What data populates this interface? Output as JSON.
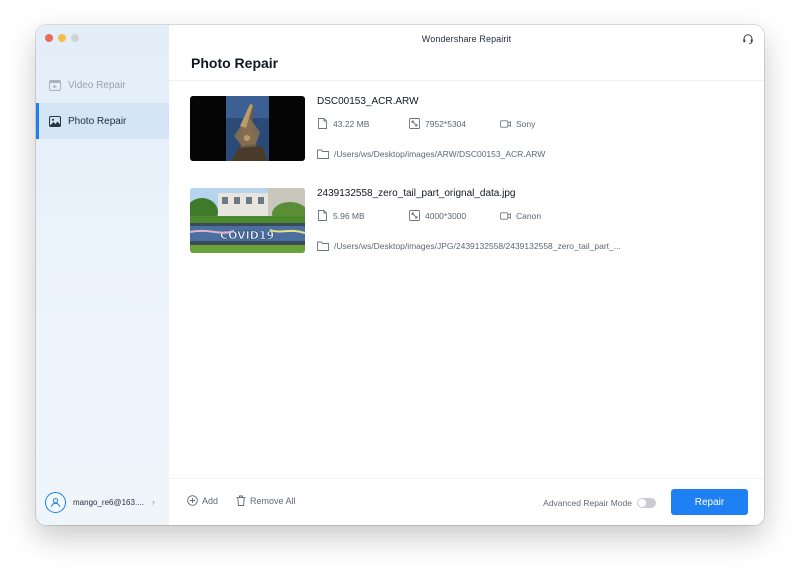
{
  "window": {
    "title": "Wondershare Repairit"
  },
  "colors": {
    "accent": "#1e80f2",
    "traffic_red": "#ec6a5e",
    "traffic_yellow": "#f4bf4f",
    "traffic_gray": "#d0d3d6"
  },
  "sidebar": {
    "items": [
      {
        "label": "Video Repair",
        "icon": "video-repair-icon",
        "active": false
      },
      {
        "label": "Photo Repair",
        "icon": "photo-repair-icon",
        "active": true
      }
    ],
    "user": {
      "name": "mango_re6@163....",
      "icon": "user-avatar-icon"
    }
  },
  "main": {
    "page_title": "Photo Repair",
    "files": [
      {
        "name": "DSC00153_ACR.ARW",
        "size": "43.22 MB",
        "resolution": "7952*5304",
        "camera": "Sony",
        "path": "/Users/ws/Desktop/images/ARW/DSC00153_ACR.ARW"
      },
      {
        "name": "2439132558_zero_tail_part_orignal_data.jpg",
        "size": "5.96 MB",
        "resolution": "4000*3000",
        "camera": "Canon",
        "path": "/Users/ws/Desktop/images/JPG/2439132558/2439132558_zero_tail_part_..."
      }
    ]
  },
  "bottom_bar": {
    "add_label": "Add",
    "remove_all_label": "Remove All",
    "advanced_mode_label": "Advanced Repair Mode",
    "advanced_mode_on": false,
    "repair_label": "Repair"
  }
}
